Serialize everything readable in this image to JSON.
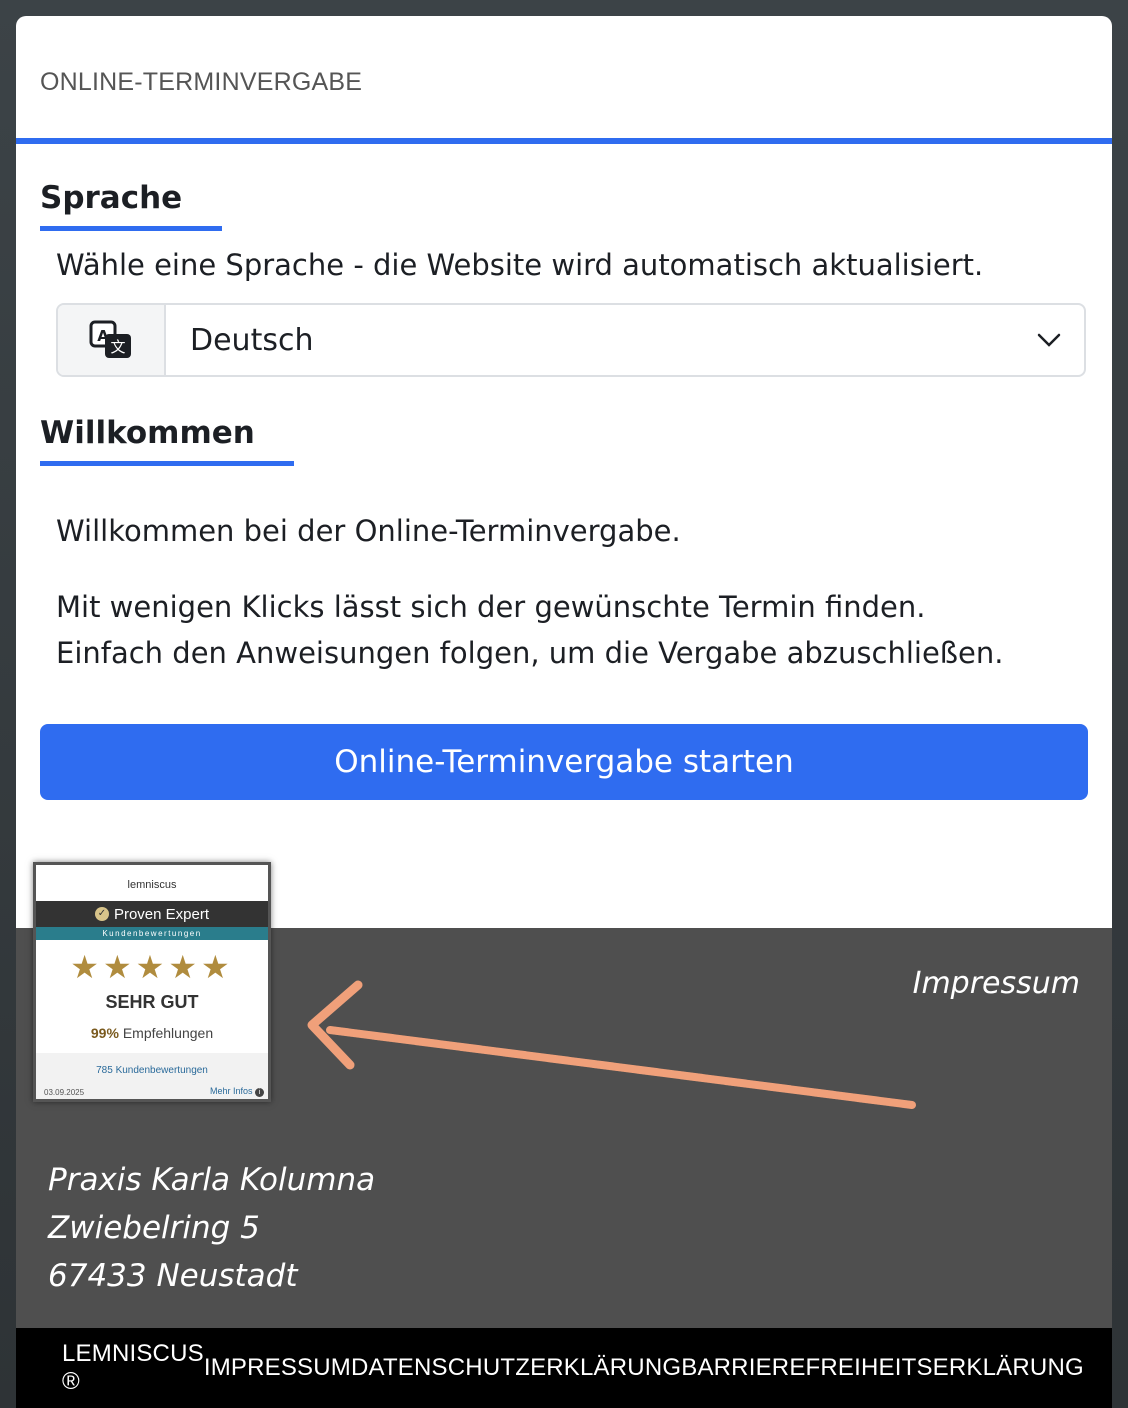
{
  "header": {
    "title": "ONLINE-TERMINVERGABE"
  },
  "language": {
    "heading": "Sprache",
    "description": "Wähle eine Sprache - die Website wird automatisch aktualisiert.",
    "selected": "Deutsch"
  },
  "welcome": {
    "heading": "Willkommen",
    "line1": "Willkommen bei der Online-Terminvergabe.",
    "line2": "Mit wenigen Klicks lässt sich der gewünschte Termin finden.",
    "line3": "Einfach den Anweisungen folgen, um die Vergabe abzuschließen.",
    "start_button": "Online-Terminvergabe starten"
  },
  "badge": {
    "company": "lemniscus",
    "brand": "Proven Expert",
    "subtitle": "Kundenbewertungen",
    "stars": 5,
    "rating": "SEHR GUT",
    "recommend_pct": "99%",
    "recommend_label": "Empfehlungen",
    "reviews": "785 Kundenbewertungen",
    "date": "03.09.2025",
    "more": "Mehr Infos"
  },
  "footer": {
    "impressum": "Impressum",
    "address_line1": "Praxis Karla Kolumna",
    "address_line2": "Zwiebelring 5",
    "address_line3": "67433 Neustadt"
  },
  "bottom_links": {
    "lemniscus": "LEMNISCUS ®",
    "impressum": "IMPRESSUM",
    "datenschutz": "DATENSCHUTZERKLÄRUNG",
    "barrierefreiheit": "BARRIEREFREIHEITSERKLÄRUNG"
  },
  "colors": {
    "accent": "#2f6cf0",
    "footer_bg": "#4f4f4f",
    "star": "#b08c3e",
    "arrow": "#f0a07a"
  }
}
